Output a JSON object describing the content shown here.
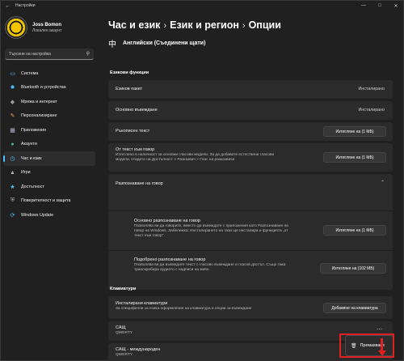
{
  "window": {
    "title": "Настройки",
    "back_icon": "back-arrow-icon",
    "controls": [
      "minimize-icon",
      "maximize-icon",
      "close-icon"
    ]
  },
  "profile": {
    "name": "Joss Bomon",
    "account": "Локален акаунт"
  },
  "search": {
    "placeholder": "Търсене на настройка"
  },
  "nav": [
    {
      "label": "Система",
      "icon": "system-icon",
      "color": "#4cc2ff",
      "active": false
    },
    {
      "label": "Bluetooth и устройства",
      "icon": "bluetooth-icon",
      "color": "#4cc2ff",
      "active": false
    },
    {
      "label": "Мрежа и интернет",
      "icon": "network-icon",
      "color": "#9aa0a6",
      "active": false
    },
    {
      "label": "Персонализиране",
      "icon": "brush-icon",
      "color": "#f0a050",
      "active": false
    },
    {
      "label": "Приложения",
      "icon": "apps-icon",
      "color": "#b0b0d0",
      "active": false
    },
    {
      "label": "Акаунти",
      "icon": "account-icon",
      "color": "#40c080",
      "active": false
    },
    {
      "label": "Час и език",
      "icon": "time-language-icon",
      "color": "#4cc2ff",
      "active": true
    },
    {
      "label": "Игри",
      "icon": "gaming-icon",
      "color": "#b0b0b0",
      "active": false
    },
    {
      "label": "Достъпност",
      "icon": "accessibility-icon",
      "color": "#4cc2ff",
      "active": false
    },
    {
      "label": "Поверителност и защита",
      "icon": "shield-icon",
      "color": "#b0b0b0",
      "active": false
    },
    {
      "label": "Windows Update",
      "icon": "update-icon",
      "color": "#4cc2ff",
      "active": false
    }
  ],
  "breadcrumb": [
    "Час и език",
    "Език и регион",
    "Опции"
  ],
  "language": "Английски (Съединени щати)",
  "sections": {
    "language_features": "Езикови функции",
    "keyboards": "Клавиатури"
  },
  "features": {
    "lang_pack": {
      "label": "Езиков пакет",
      "value": "Инсталирано"
    },
    "basic_typing": {
      "label": "Основно въвеждане",
      "value": "Инсталирано"
    },
    "handwriting": {
      "label": "Ръкописен текст",
      "button": "Изтегляне на (1 МБ)"
    },
    "tts": {
      "label": "От текст към говор",
      "desc1": "Изтеглено в наличност за основни гласови модели. За да добавите естествени гласови",
      "desc2": "модели, отидете на Достъпност > Разказвач > Глас на разказвача",
      "button": "Изтегляне на (1 МБ)"
    },
    "speech": {
      "label": "Разпознаване на говор"
    },
    "basic_speech": {
      "label": "Основно разпознаване на говор",
      "desc1": "Позволява ви да говорите, вместо да въвеждате с приложения като Разпознаване на",
      "desc2": "говор на Windows. Забележка: Инсталирането на тази ще инсталира и функцията „от",
      "desc3": "текст към говор\".",
      "button": "Изтегляне на (1 МБ)"
    },
    "enhanced_speech": {
      "label": "Подобрено разпознаване на говор",
      "desc1": "Позволява ви да въвеждате текст с гласово въвеждане и гласов достъп. Също така",
      "desc2": "транскрибира аудиото с надписи на живо.",
      "button": "Изтегляне на (102 МБ)"
    }
  },
  "keyboards": {
    "installed": {
      "label": "Инсталирани клавиатури",
      "desc": "За специфични за езика оформления на клавиатура и опции за въвеждане",
      "button": "Добавяне на клавиатура"
    },
    "items": [
      {
        "name": "САЩ",
        "layout": "QWERTY"
      },
      {
        "name": "САЩ - международен",
        "layout": "QWERTY"
      }
    ]
  },
  "context_menu": {
    "icon": "trash-icon",
    "label": "Премахване"
  }
}
